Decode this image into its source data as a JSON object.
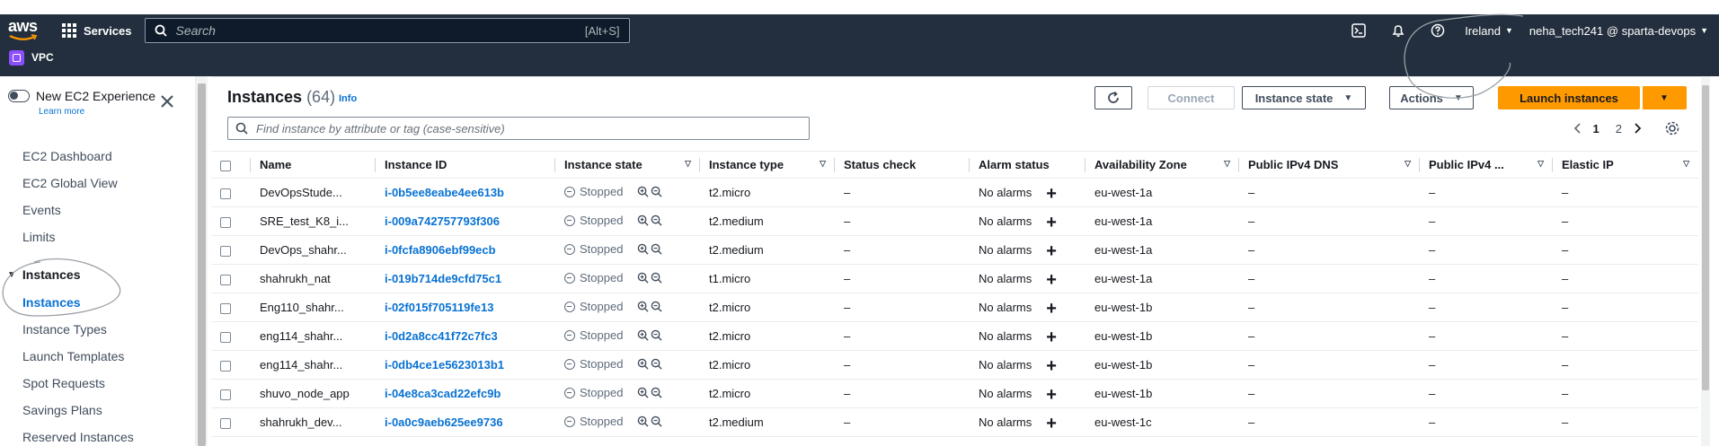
{
  "topbar": {
    "logo": "aws",
    "services_label": "Services",
    "search_placeholder": "Search",
    "search_shortcut": "[Alt+S]",
    "region": "Ireland",
    "account": "neha_tech241 @ sparta-devops",
    "service_badge": "VPC"
  },
  "sidebar": {
    "toggle_label": "New EC2 Experience",
    "learn_more": "Learn more",
    "items": [
      {
        "label": "EC2 Dashboard"
      },
      {
        "label": "EC2 Global View"
      },
      {
        "label": "Events"
      },
      {
        "label": "Limits"
      }
    ],
    "group": {
      "label": "Instances"
    },
    "sub_items": [
      {
        "label": "Instances"
      },
      {
        "label": "Instance Types"
      },
      {
        "label": "Launch Templates"
      },
      {
        "label": "Spot Requests"
      },
      {
        "label": "Savings Plans"
      },
      {
        "label": "Reserved Instances"
      }
    ]
  },
  "header": {
    "title": "Instances",
    "count": "(64)",
    "info": "Info",
    "connect": "Connect",
    "instance_state": "Instance state",
    "actions": "Actions",
    "launch": "Launch instances",
    "filter_placeholder": "Find instance by attribute or tag (case-sensitive)",
    "pages": [
      "1",
      "2"
    ]
  },
  "table": {
    "columns": [
      "Name",
      "Instance ID",
      "Instance state",
      "Instance type",
      "Status check",
      "Alarm status",
      "Availability Zone",
      "Public IPv4 DNS",
      "Public IPv4 ...",
      "Elastic IP"
    ],
    "rows": [
      {
        "name": "DevOpsStude...",
        "id": "i-0b5ee8eabe4ee613b",
        "state": "Stopped",
        "type": "t2.micro",
        "status": "–",
        "alarm": "No alarms",
        "az": "eu-west-1a",
        "dns": "–",
        "ipv4": "–",
        "eip": "–"
      },
      {
        "name": "SRE_test_K8_i...",
        "id": "i-009a742757793f306",
        "state": "Stopped",
        "type": "t2.medium",
        "status": "–",
        "alarm": "No alarms",
        "az": "eu-west-1a",
        "dns": "–",
        "ipv4": "–",
        "eip": "–"
      },
      {
        "name": "DevOps_shahr...",
        "id": "i-0fcfa8906ebf99ecb",
        "state": "Stopped",
        "type": "t2.medium",
        "status": "–",
        "alarm": "No alarms",
        "az": "eu-west-1a",
        "dns": "–",
        "ipv4": "–",
        "eip": "–"
      },
      {
        "name": "shahrukh_nat",
        "id": "i-019b714de9cfd75c1",
        "state": "Stopped",
        "type": "t1.micro",
        "status": "–",
        "alarm": "No alarms",
        "az": "eu-west-1a",
        "dns": "–",
        "ipv4": "–",
        "eip": "–"
      },
      {
        "name": "Eng110_shahr...",
        "id": "i-02f015f705119fe13",
        "state": "Stopped",
        "type": "t2.micro",
        "status": "–",
        "alarm": "No alarms",
        "az": "eu-west-1b",
        "dns": "–",
        "ipv4": "–",
        "eip": "–"
      },
      {
        "name": "eng114_shahr...",
        "id": "i-0d2a8cc41f72c7fc3",
        "state": "Stopped",
        "type": "t2.micro",
        "status": "–",
        "alarm": "No alarms",
        "az": "eu-west-1b",
        "dns": "–",
        "ipv4": "–",
        "eip": "–"
      },
      {
        "name": "eng114_shahr...",
        "id": "i-0db4ce1e5623013b1",
        "state": "Stopped",
        "type": "t2.micro",
        "status": "–",
        "alarm": "No alarms",
        "az": "eu-west-1b",
        "dns": "–",
        "ipv4": "–",
        "eip": "–"
      },
      {
        "name": "shuvo_node_app",
        "id": "i-04e8ca3cad22efc9b",
        "state": "Stopped",
        "type": "t2.micro",
        "status": "–",
        "alarm": "No alarms",
        "az": "eu-west-1b",
        "dns": "–",
        "ipv4": "–",
        "eip": "–"
      },
      {
        "name": "shahrukh_dev...",
        "id": "i-0a0c9aeb625ee9736",
        "state": "Stopped",
        "type": "t2.medium",
        "status": "–",
        "alarm": "No alarms",
        "az": "eu-west-1c",
        "dns": "–",
        "ipv4": "–",
        "eip": "–"
      }
    ]
  }
}
